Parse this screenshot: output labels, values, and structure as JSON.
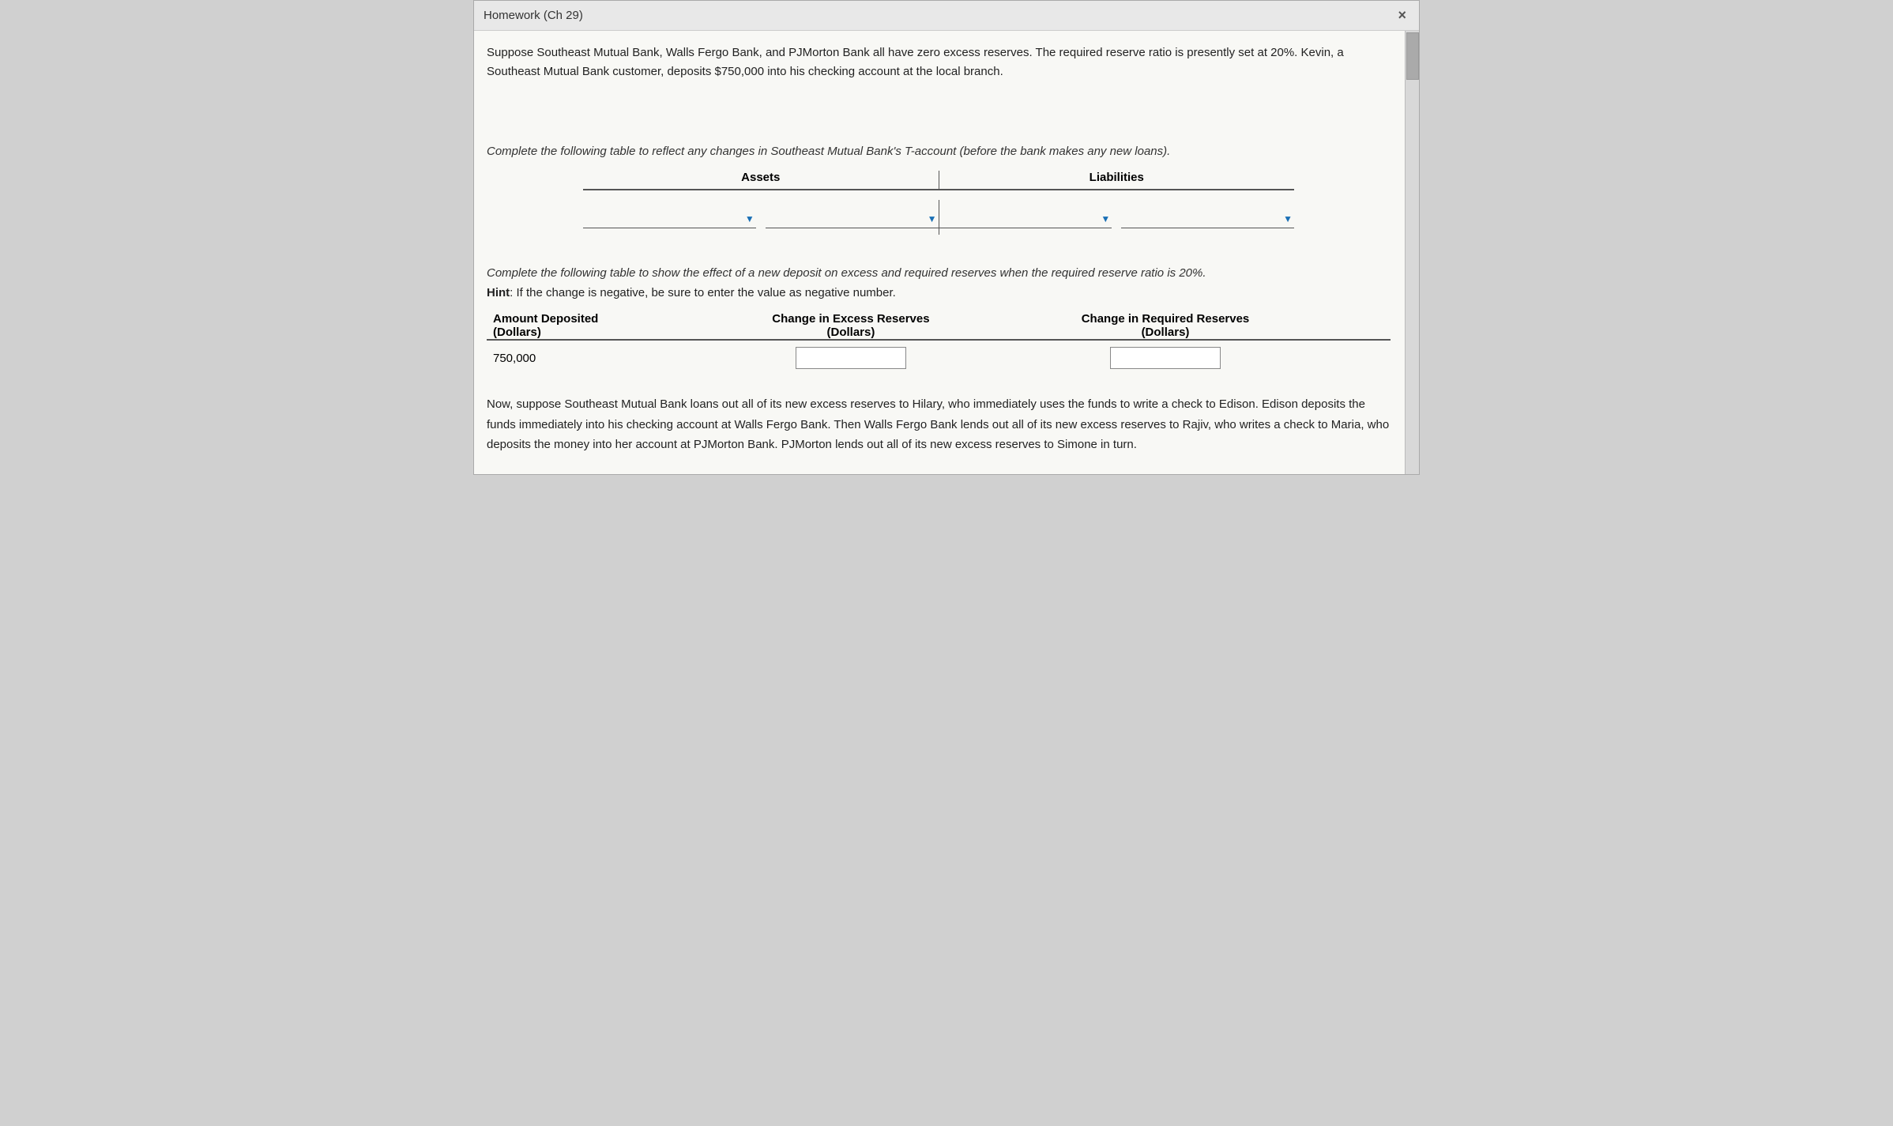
{
  "window": {
    "title": "Homework (Ch 29)",
    "close_label": "×"
  },
  "intro": {
    "paragraph": "Suppose Southeast Mutual Bank, Walls Fergo Bank, and PJMorton Bank all have zero excess reserves. The required reserve ratio is presently set at 20%. Kevin, a Southeast Mutual Bank customer, deposits $750,000 into his checking account at the local branch."
  },
  "t_account": {
    "instruction": "Complete the following table to reflect any changes in Southeast Mutual Bank's T-account (before the bank makes any new loans).",
    "assets_label": "Assets",
    "liabilities_label": "Liabilities",
    "dropdown_placeholder": ""
  },
  "reserves_table": {
    "instruction": "Complete the following table to show the effect of a new deposit on excess and required reserves when the required reserve ratio is 20%.",
    "hint_bold": "Hint",
    "hint_text": ": If the change is negative, be sure to enter the value as negative number.",
    "col1_header_line1": "Amount Deposited",
    "col1_header_line2": "(Dollars)",
    "col2_header_line1": "Change in Excess Reserves",
    "col2_header_line2": "(Dollars)",
    "col3_header_line1": "Change in Required Reserves",
    "col3_header_line2": "(Dollars)",
    "row1_col1": "750,000",
    "row1_col2_value": "",
    "row1_col3_value": ""
  },
  "now_paragraph": {
    "text": "Now, suppose Southeast Mutual Bank loans out all of its new excess reserves to Hilary, who immediately uses the funds to write a check to Edison. Edison deposits the funds immediately into his checking account at Walls Fergo Bank. Then Walls Fergo Bank lends out all of its new excess reserves to Rajiv, who writes a check to Maria, who deposits the money into her account at PJMorton Bank. PJMorton lends out all of its new excess reserves to Simone in turn."
  }
}
